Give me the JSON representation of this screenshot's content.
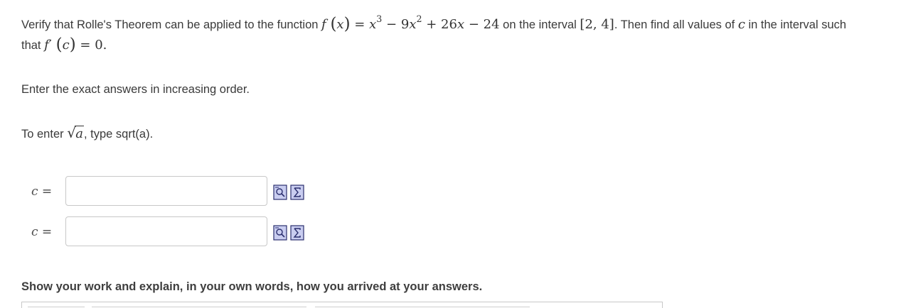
{
  "question": {
    "intro": "Verify that Rolle's Theorem can be applied to the function",
    "function_expr": {
      "f": "f",
      "x": "x",
      "eq": "=",
      "term1_base": "x",
      "term1_exp": "3",
      "op1": "−",
      "term2_coef": "9",
      "term2_base": "x",
      "term2_exp": "2",
      "op2": "+",
      "term3": "26",
      "term3_var": "x",
      "op3": "−",
      "term4": "24"
    },
    "mid": "on the interval",
    "interval": "[2, 4]",
    "after_interval": ". Then find all values of",
    "c_var": "c",
    "after_c": "in the interval such",
    "line2_prefix": "that",
    "line2_expr": {
      "f": "f",
      "prime": "′",
      "arg": "c",
      "rhs": "= 0."
    }
  },
  "instruction": "Enter the exact answers in increasing order.",
  "hint": {
    "prefix": "To enter",
    "radicand": "a",
    "suffix": ", type sqrt(a)."
  },
  "answers": [
    {
      "label": "c =",
      "value": "",
      "placeholder": ""
    },
    {
      "label": "c =",
      "value": "",
      "placeholder": ""
    }
  ],
  "icons": {
    "preview": "preview-icon",
    "equation_editor": "sigma-icon"
  },
  "work_heading": "Show your work and explain, in your own words, how you arrived at your answers.",
  "colors": {
    "text": "#3a3a3a",
    "input_border": "#c8c8c8",
    "icon_fill": "#c9cdf0",
    "icon_stroke": "#2b2f6e"
  }
}
